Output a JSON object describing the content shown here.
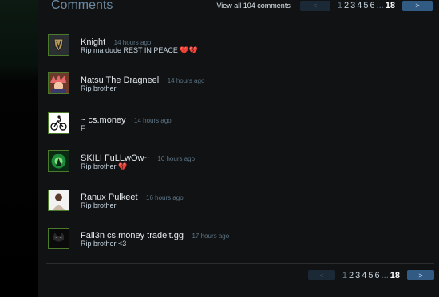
{
  "header": {
    "title": "Comments",
    "view_all": "View all 104 comments",
    "prev": "<",
    "next": ">",
    "pages": [
      "1",
      "2",
      "3",
      "4",
      "5",
      "6"
    ],
    "ellipsis": "...",
    "last_page": "18"
  },
  "comments": [
    {
      "author": "Knight",
      "time": "14 hours ago",
      "text": "Rip ma dude REST IN PEACE",
      "hearts": 2,
      "avatar_icon": "shield-avatar-icon"
    },
    {
      "author": "Natsu The Dragneel",
      "time": "14 hours ago",
      "text": "Rip brother",
      "hearts": 0,
      "avatar_icon": "anime-avatar-icon"
    },
    {
      "author": "~ cs.money",
      "time": "14 hours ago",
      "text": "F",
      "hearts": 0,
      "avatar_icon": "bike-avatar-icon"
    },
    {
      "author": "SKILI FuLLwOw~",
      "time": "16 hours ago",
      "text": "Rip brother",
      "hearts": 1,
      "avatar_icon": "green-glow-avatar-icon"
    },
    {
      "author": "Ranux Pulkeet",
      "time": "16 hours ago",
      "text": "Rip brother",
      "hearts": 0,
      "avatar_icon": "person-avatar-icon"
    },
    {
      "author": "Fall3n cs.money tradeit.gg",
      "time": "17 hours ago",
      "text": "Rip brother <3",
      "hearts": 0,
      "avatar_icon": "bat-avatar-icon"
    }
  ],
  "footer": {
    "prev": "<",
    "next": ">",
    "pages": [
      "1",
      "2",
      "3",
      "4",
      "5",
      "6"
    ],
    "ellipsis": "...",
    "last_page": "18"
  },
  "colors": {
    "accent": "#325b84",
    "heart": "#c42a2a",
    "avatar_border": "#4a7a2a"
  }
}
